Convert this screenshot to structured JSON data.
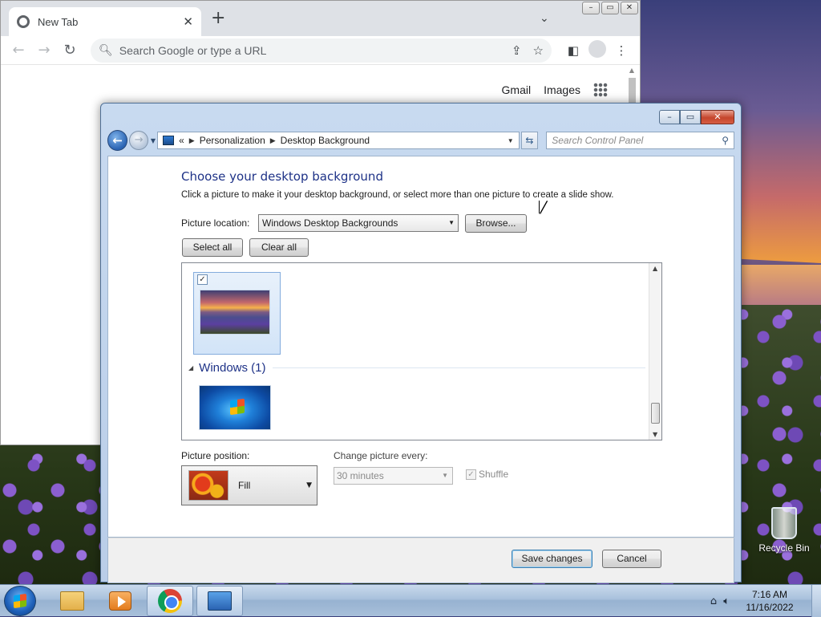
{
  "chrome": {
    "tab_title": "New Tab",
    "tab_close": "✕",
    "new_tab": "+",
    "omnibox_placeholder": "Search Google or type a URL",
    "links": {
      "gmail": "Gmail",
      "images": "Images"
    }
  },
  "control_panel": {
    "breadcrumb": {
      "chevron": "«",
      "parent": "Personalization",
      "current": "Desktop Background"
    },
    "search_placeholder": "Search Control Panel",
    "heading": "Choose your desktop background",
    "description": "Click a picture to make it your desktop background, or select more than one picture to create a slide show.",
    "picture_location_label": "Picture location:",
    "picture_location_value": "Windows Desktop Backgrounds",
    "browse_label": "Browse...",
    "select_all_label": "Select all",
    "clear_all_label": "Clear all",
    "picture_list": {
      "items": [
        {
          "group": "",
          "checked": true,
          "selected": true
        },
        {
          "group": "Windows (1)",
          "checked": false,
          "selected": false
        }
      ],
      "group_header": "Windows (1)"
    },
    "picture_position_label": "Picture position:",
    "picture_position_value": "Fill",
    "change_interval_label": "Change picture every:",
    "change_interval_value": "30 minutes",
    "shuffle_label": "Shuffle",
    "shuffle_checked": true,
    "save_label": "Save changes",
    "cancel_label": "Cancel"
  },
  "desktop": {
    "recycle_bin_label": "Recycle Bin"
  },
  "taskbar": {
    "time": "7:16 AM",
    "date": "11/16/2022",
    "items": [
      "windows-explorer",
      "media-player",
      "google-chrome",
      "control-panel"
    ]
  },
  "icons": {
    "checkmark": "✓",
    "down_arrow": "▼",
    "up_arrow": "▲",
    "triangle": "◢",
    "search": "⌕"
  }
}
